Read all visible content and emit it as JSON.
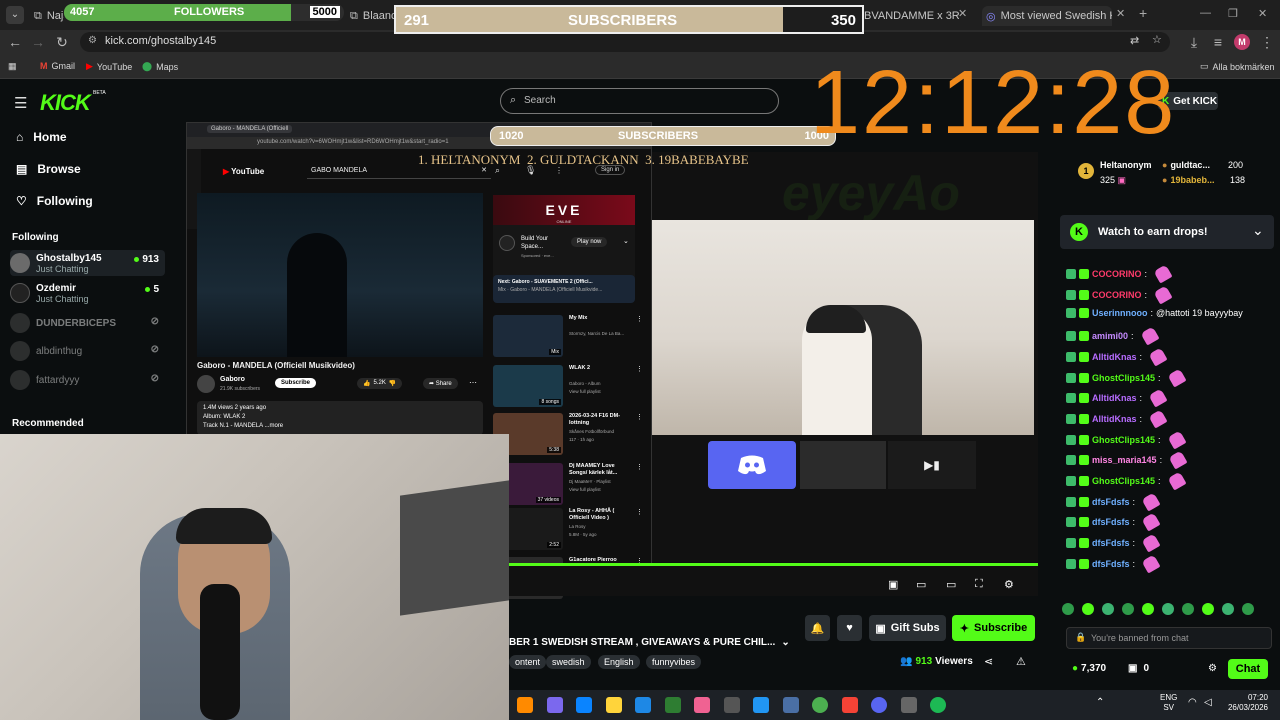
{
  "browser": {
    "tabs": [
      {
        "label": "Naja"
      },
      {
        "label": "Blaancos"
      },
      {
        "label": "BVANDAMME x 3ROBI -"
      },
      {
        "label": "Most viewed Swedish Kick Stre"
      }
    ],
    "url": "kick.com/ghostalby145",
    "bookmarks": [
      "Gmail",
      "YouTube",
      "Maps"
    ],
    "all_bookmarks": "Alla bokmärken",
    "profile_initial": "M"
  },
  "overlays": {
    "followers_goal": {
      "current": "4057",
      "label": "FOLLOWERS",
      "target": "5000",
      "progress": 0.81
    },
    "subs_goal_top": {
      "current": "291",
      "label": "SUBSCRIBERS",
      "target": "350",
      "progress": 0.83
    },
    "subs_goal_mid": {
      "current": "1020",
      "label": "SUBSCRIBERS",
      "target": "1000"
    },
    "leaderboard": "1. HELTANONYM  2. GULDTACKANN  3. 19BABEBAYBE",
    "clock": "12:12:28"
  },
  "kick": {
    "logo": "KICK",
    "beta": "BETA",
    "search_placeholder": "Search",
    "nav": [
      {
        "label": "Home",
        "icon": "home-icon"
      },
      {
        "label": "Browse",
        "icon": "browse-icon"
      },
      {
        "label": "Following",
        "icon": "heart-icon"
      }
    ],
    "following_header": "Following",
    "following": [
      {
        "name": "Ghostalby145",
        "sub": "Just Chatting",
        "count": "913",
        "live": true
      },
      {
        "name": "Ozdemir",
        "sub": "Just Chatting",
        "count": "5",
        "live": true
      },
      {
        "name": "DUNDERBICEPS",
        "live": false
      },
      {
        "name": "albdinthug",
        "live": false
      },
      {
        "name": "fattardyyy",
        "live": false
      }
    ],
    "recommended_header": "Recommended",
    "stream_title": "BER 1 SWEDISH STREAM , GIVEAWAYS & PURE CHIL...",
    "tags": [
      "ontent",
      "swedish",
      "English",
      "funnyvibes"
    ],
    "gift_subs": "Gift Subs",
    "subscribe": "Subscribe",
    "viewers_count": "913",
    "viewers_label": "Viewers",
    "get_kick": "Get KICK"
  },
  "youtube": {
    "tab": "Gaboro - MANDELA (Officiell",
    "url": "youtube.com/watch?v=6WOHmjt1w&list=RD6WOHmjt1w&start_radio=1",
    "search": "GABO MANDELA",
    "sign_in": "Sign in",
    "video_title": "Gaboro - MANDELA (Officiell Musikvideo)",
    "channel": "Gaboro",
    "subs": "21.9K subscribers",
    "subscribe": "Subscribe",
    "likes": "5.2K",
    "share": "Share",
    "desc": [
      "1.4M views  2 years ago",
      "Album: WLAK 2",
      "Track N.1 - MANDELA ...more"
    ],
    "ad": {
      "brand": "EVE",
      "sub": "ONLINE",
      "text": "Build Your Space...",
      "cta": "Play now",
      "sponsored": "Sponsored · eve..."
    },
    "next": "Next: Gaboro - SUAVEMENTE 2 (Offici...",
    "next_sub": "Mix · Gaboro - MANDELA (Officiell Musikvide...",
    "playlist": [
      {
        "title": "My Mix",
        "sub": "Stormzy, Narcis De La Ba...",
        "badge": "Mix"
      },
      {
        "title": "WLAK 2",
        "sub": "Gaboro - Album",
        "sub2": "View full playlist",
        "badge": "8 songs"
      },
      {
        "title": "2026-03-24 F16 DM-lottning",
        "sub": "Skånes Fotbollförbund",
        "sub2": "117 · 1h ago",
        "badge": "5:38"
      },
      {
        "title": "Dj MAAMEY Love Songs/ kärlek låt...",
        "sub": "Dj MaaMeY · Playlist",
        "sub2": "View full playlist",
        "badge": "37 videos"
      },
      {
        "title": "La Rosy - AHHÄ ( Officiell Video )",
        "sub": "La Rosy",
        "sub2": "5.8M · 5y ago",
        "badge": "2:52"
      },
      {
        "title": "G1acatore Pierroo [OFFICIE...",
        "sub": "",
        "sub2": "",
        "badge": ""
      }
    ]
  },
  "chat": {
    "top_gifters": [
      {
        "rank": "1",
        "name": "Heltanonym",
        "count": "325"
      },
      {
        "name": "guldtac...",
        "count": "200"
      },
      {
        "name": "19babeb...",
        "count": "138"
      }
    ],
    "drops": "Watch to earn drops!",
    "messages": [
      {
        "user": "COCORINO",
        "color": "#ff3b6b",
        "text": ""
      },
      {
        "user": "COCORINO",
        "color": "#ff3b6b",
        "text": ""
      },
      {
        "user": "Userinnnooo",
        "color": "#6fb0ff",
        "text": "@hattoti 19 bayyybay"
      },
      {
        "user": "amimi00",
        "color": "#c58aff",
        "text": ""
      },
      {
        "user": "AlltidKnas",
        "color": "#b76cff",
        "text": ""
      },
      {
        "user": "GhostClips145",
        "color": "#53fc18",
        "text": ""
      },
      {
        "user": "AlltidKnas",
        "color": "#b76cff",
        "text": ""
      },
      {
        "user": "AlltidKnas",
        "color": "#b76cff",
        "text": ""
      },
      {
        "user": "GhostClips145",
        "color": "#53fc18",
        "text": ""
      },
      {
        "user": "miss_maria145",
        "color": "#ff86e4",
        "text": ""
      },
      {
        "user": "GhostClips145",
        "color": "#53fc18",
        "text": ""
      },
      {
        "user": "dfsFdsfs",
        "color": "#6fb0ff",
        "text": ""
      },
      {
        "user": "dfsFdsfs",
        "color": "#6fb0ff",
        "text": ""
      },
      {
        "user": "dfsFdsfs",
        "color": "#6fb0ff",
        "text": ""
      },
      {
        "user": "dfsFdsfs",
        "color": "#6fb0ff",
        "text": ""
      }
    ],
    "banned": "You're banned from chat",
    "points": "7,370",
    "gift_count": "0",
    "chat_button": "Chat"
  },
  "taskbar": {
    "lang": "ENG",
    "region": "SV",
    "time": "07:20",
    "date": "26/03/2026",
    "search": "Search"
  },
  "colors": {
    "kick_green": "#53fc18",
    "clock_orange": "#f08a1c",
    "discord": "#5865f2"
  }
}
